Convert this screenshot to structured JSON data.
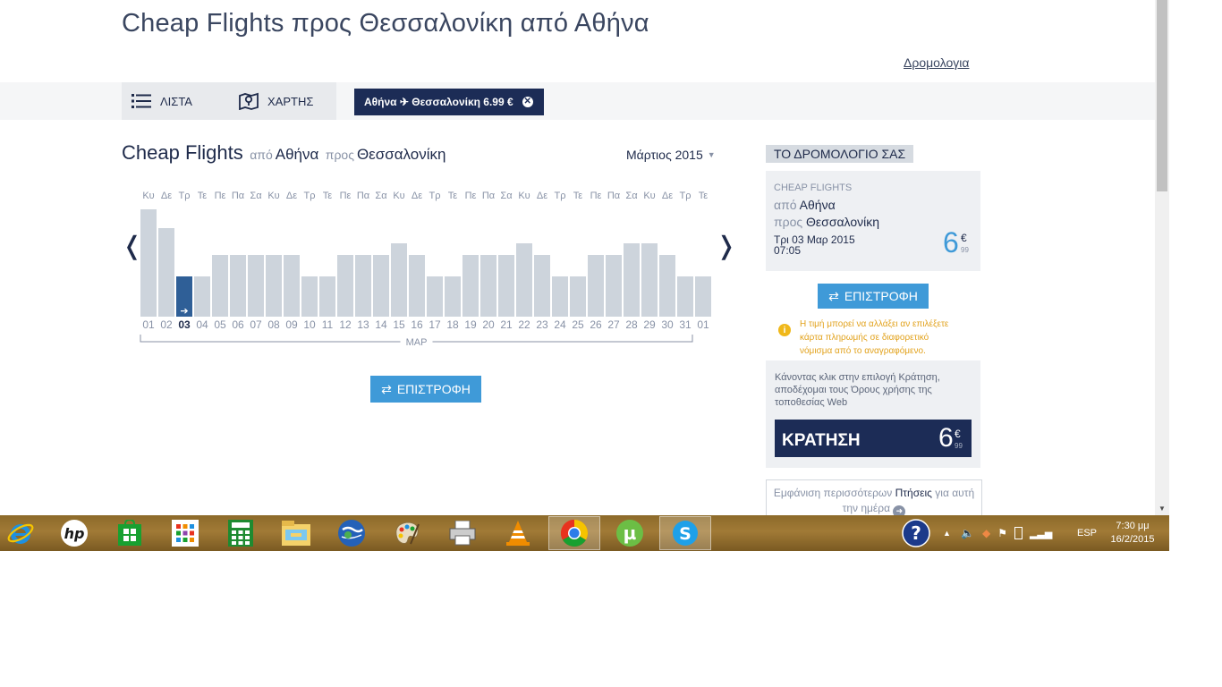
{
  "header": {
    "title": "Cheap Flights προς Θεσσαλονίκη από Αθήνα",
    "itinerary_link": "Δρομολογια"
  },
  "toolbar": {
    "list_label": "ΛΙΣΤΑ",
    "map_label": "ΧΑΡΤΗΣ",
    "filter_pill": "Αθήνα ✈ Θεσσαλονίκη 6.99 €"
  },
  "calendar": {
    "heading_main": "Cheap Flights",
    "from_word": "από",
    "from_city": "Αθήνα",
    "to_word": "προς",
    "to_city": "Θεσσαλονίκη",
    "month_select": "Μάρτιος 2015",
    "prev_arrow": "❬",
    "next_arrow": "❭",
    "month_abbrev": "ΜΑΡ",
    "return_button": "ΕΠΙΣΤΡΟΦΗ"
  },
  "chart_data": {
    "type": "bar",
    "title": "",
    "xlabel": "ΜΑΡ",
    "ylabel": "",
    "selected_category": "03",
    "categories": [
      "01",
      "02",
      "03",
      "04",
      "05",
      "06",
      "07",
      "08",
      "09",
      "10",
      "11",
      "12",
      "13",
      "14",
      "15",
      "16",
      "17",
      "18",
      "19",
      "20",
      "21",
      "22",
      "23",
      "24",
      "25",
      "26",
      "27",
      "28",
      "29",
      "30",
      "31",
      "01"
    ],
    "weekdays": [
      "Κυ",
      "Δε",
      "Τρ",
      "Τε",
      "Πε",
      "Πα",
      "Σα",
      "Κυ",
      "Δε",
      "Τρ",
      "Τε",
      "Πε",
      "Πα",
      "Σα",
      "Κυ",
      "Δε",
      "Τρ",
      "Τε",
      "Πε",
      "Πα",
      "Σα",
      "Κυ",
      "Δε",
      "Τρ",
      "Τε",
      "Πε",
      "Πα",
      "Σα",
      "Κυ",
      "Δε",
      "Τρ",
      "Τε"
    ],
    "values": [
      120,
      99,
      45,
      45,
      69,
      69,
      69,
      69,
      69,
      45,
      45,
      69,
      69,
      69,
      82,
      69,
      45,
      45,
      69,
      69,
      69,
      82,
      69,
      45,
      45,
      69,
      69,
      82,
      82,
      69,
      45,
      45
    ],
    "colors": {
      "bar": "#cdd4dc",
      "selected": "#2f5f97"
    }
  },
  "itinerary": {
    "heading": "ΤΟ ΔΡΟΜΟΛΟΓΙΟ ΣΑΣ",
    "cheap_flights_label": "CHEAP FLIGHTS",
    "from_word": "από",
    "from_city": "Αθήνα",
    "to_word": "προς",
    "to_city": "Θεσσαλονίκη",
    "date": "Τρι 03 Μαρ 2015",
    "time": "07:05",
    "price_int": "6",
    "price_currency": "€",
    "price_cents": "99",
    "return_button": "ΕΠΙΣΤΡΟΦΗ",
    "warn_icon": "i",
    "price_warning": "Η τιμή μπορεί να αλλάξει αν επιλέξετε κάρτα πληρωμής σε διαφορετικό νόμισμα από το αναγραφόμενο.",
    "terms": "Κάνοντας κλικ στην επιλογή Κράτηση, αποδέχομαι τους Όρους χρήσης της τοποθεσίας Web",
    "book_label": "ΚΡΑΤΗΣΗ",
    "book_price_int": "6",
    "book_currency": "€",
    "book_cents": "99",
    "more_prefix": "Εμφάνιση περισσότερων",
    "more_highlight": "Πτήσεις",
    "more_suffix": "για αυτή την ημέρα"
  },
  "scrollbar": {
    "down_arrow": "▼"
  },
  "taskbar": {
    "apps": [
      "ie-icon",
      "hp-icon",
      "store-icon",
      "apps-icon",
      "calculator-icon",
      "file-explorer-icon",
      "google-earth-icon",
      "paint-icon",
      "printer-icon",
      "vlc-icon",
      "chrome-icon",
      "utorrent-icon",
      "skype-icon"
    ],
    "help": "?",
    "tray_arrow": "▲",
    "language": "ESP",
    "time": "7:30 μμ",
    "date": "16/2/2015",
    "colors": {
      "taskbar": "#8c6a2a"
    }
  }
}
